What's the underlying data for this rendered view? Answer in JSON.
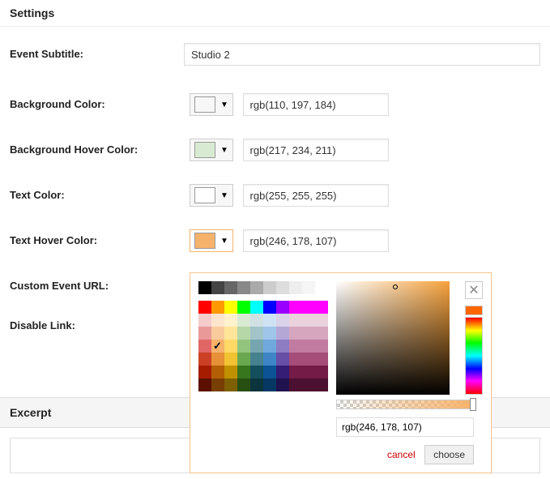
{
  "headings": {
    "settings": "Settings",
    "excerpt": "Excerpt"
  },
  "labels": {
    "subtitle": "Event Subtitle:",
    "bg": "Background Color:",
    "bg_hover": "Background Hover Color:",
    "text": "Text Color:",
    "text_hover": "Text Hover Color:",
    "custom_url": "Custom Event URL:",
    "disable_link": "Disable Link:"
  },
  "fields": {
    "subtitle": "Studio 2",
    "bg": {
      "swatch": "#6ec5b8",
      "text": "rgb(110, 197, 184)"
    },
    "bg_hover": {
      "swatch": "#d9ead3",
      "text": "rgb(217, 234, 211)"
    },
    "text": {
      "swatch": "#ffffff",
      "text": "rgb(255, 255, 255)"
    },
    "text_hover": {
      "swatch": "#f6b26b",
      "text": "rgb(246, 178, 107)"
    }
  },
  "picker": {
    "value": "rgb(246, 178, 107)",
    "cancel": "cancel",
    "choose": "choose",
    "grays": [
      "#000000",
      "#444444",
      "#666666",
      "#888888",
      "#aaaaaa",
      "#cccccc",
      "#dddddd",
      "#eeeeee",
      "#f5f5f5",
      "#ffffff"
    ],
    "grid": [
      [
        "#ff0000",
        "#ff9900",
        "#ffff00",
        "#00ff00",
        "#00ffff",
        "#0000ff",
        "#9900ff",
        "#ff00ff",
        "#ff00ff",
        "#ff00ff"
      ],
      [
        "#f4cccc",
        "#fce5cd",
        "#fff2cc",
        "#d9ead3",
        "#d0e0e3",
        "#cfe2f3",
        "#d9d2e9",
        "#ead1dc",
        "#ead1dc",
        "#ead1dc"
      ],
      [
        "#ea9999",
        "#f9cb9c",
        "#ffe599",
        "#b6d7a8",
        "#a2c4c9",
        "#9fc5e8",
        "#b4a7d6",
        "#d5a6bd",
        "#d5a6bd",
        "#d5a6bd"
      ],
      [
        "#e06666",
        "#f6b26b",
        "#ffd966",
        "#93c47d",
        "#76a5af",
        "#6fa8dc",
        "#8e7cc3",
        "#c27ba0",
        "#c27ba0",
        "#c27ba0"
      ],
      [
        "#cc4125",
        "#e69138",
        "#f1c232",
        "#6aa84f",
        "#45818e",
        "#3d85c6",
        "#674ea7",
        "#a64d79",
        "#a64d79",
        "#a64d79"
      ],
      [
        "#a61c00",
        "#b45f06",
        "#bf9000",
        "#38761d",
        "#134f5c",
        "#0b5394",
        "#351c75",
        "#741b47",
        "#741b47",
        "#741b47"
      ],
      [
        "#5b0f00",
        "#783f04",
        "#7f6000",
        "#274e13",
        "#0c343d",
        "#073763",
        "#20124d",
        "#4c1130",
        "#4c1130",
        "#4c1130"
      ]
    ],
    "checked_row": 3,
    "checked_col": 1
  }
}
